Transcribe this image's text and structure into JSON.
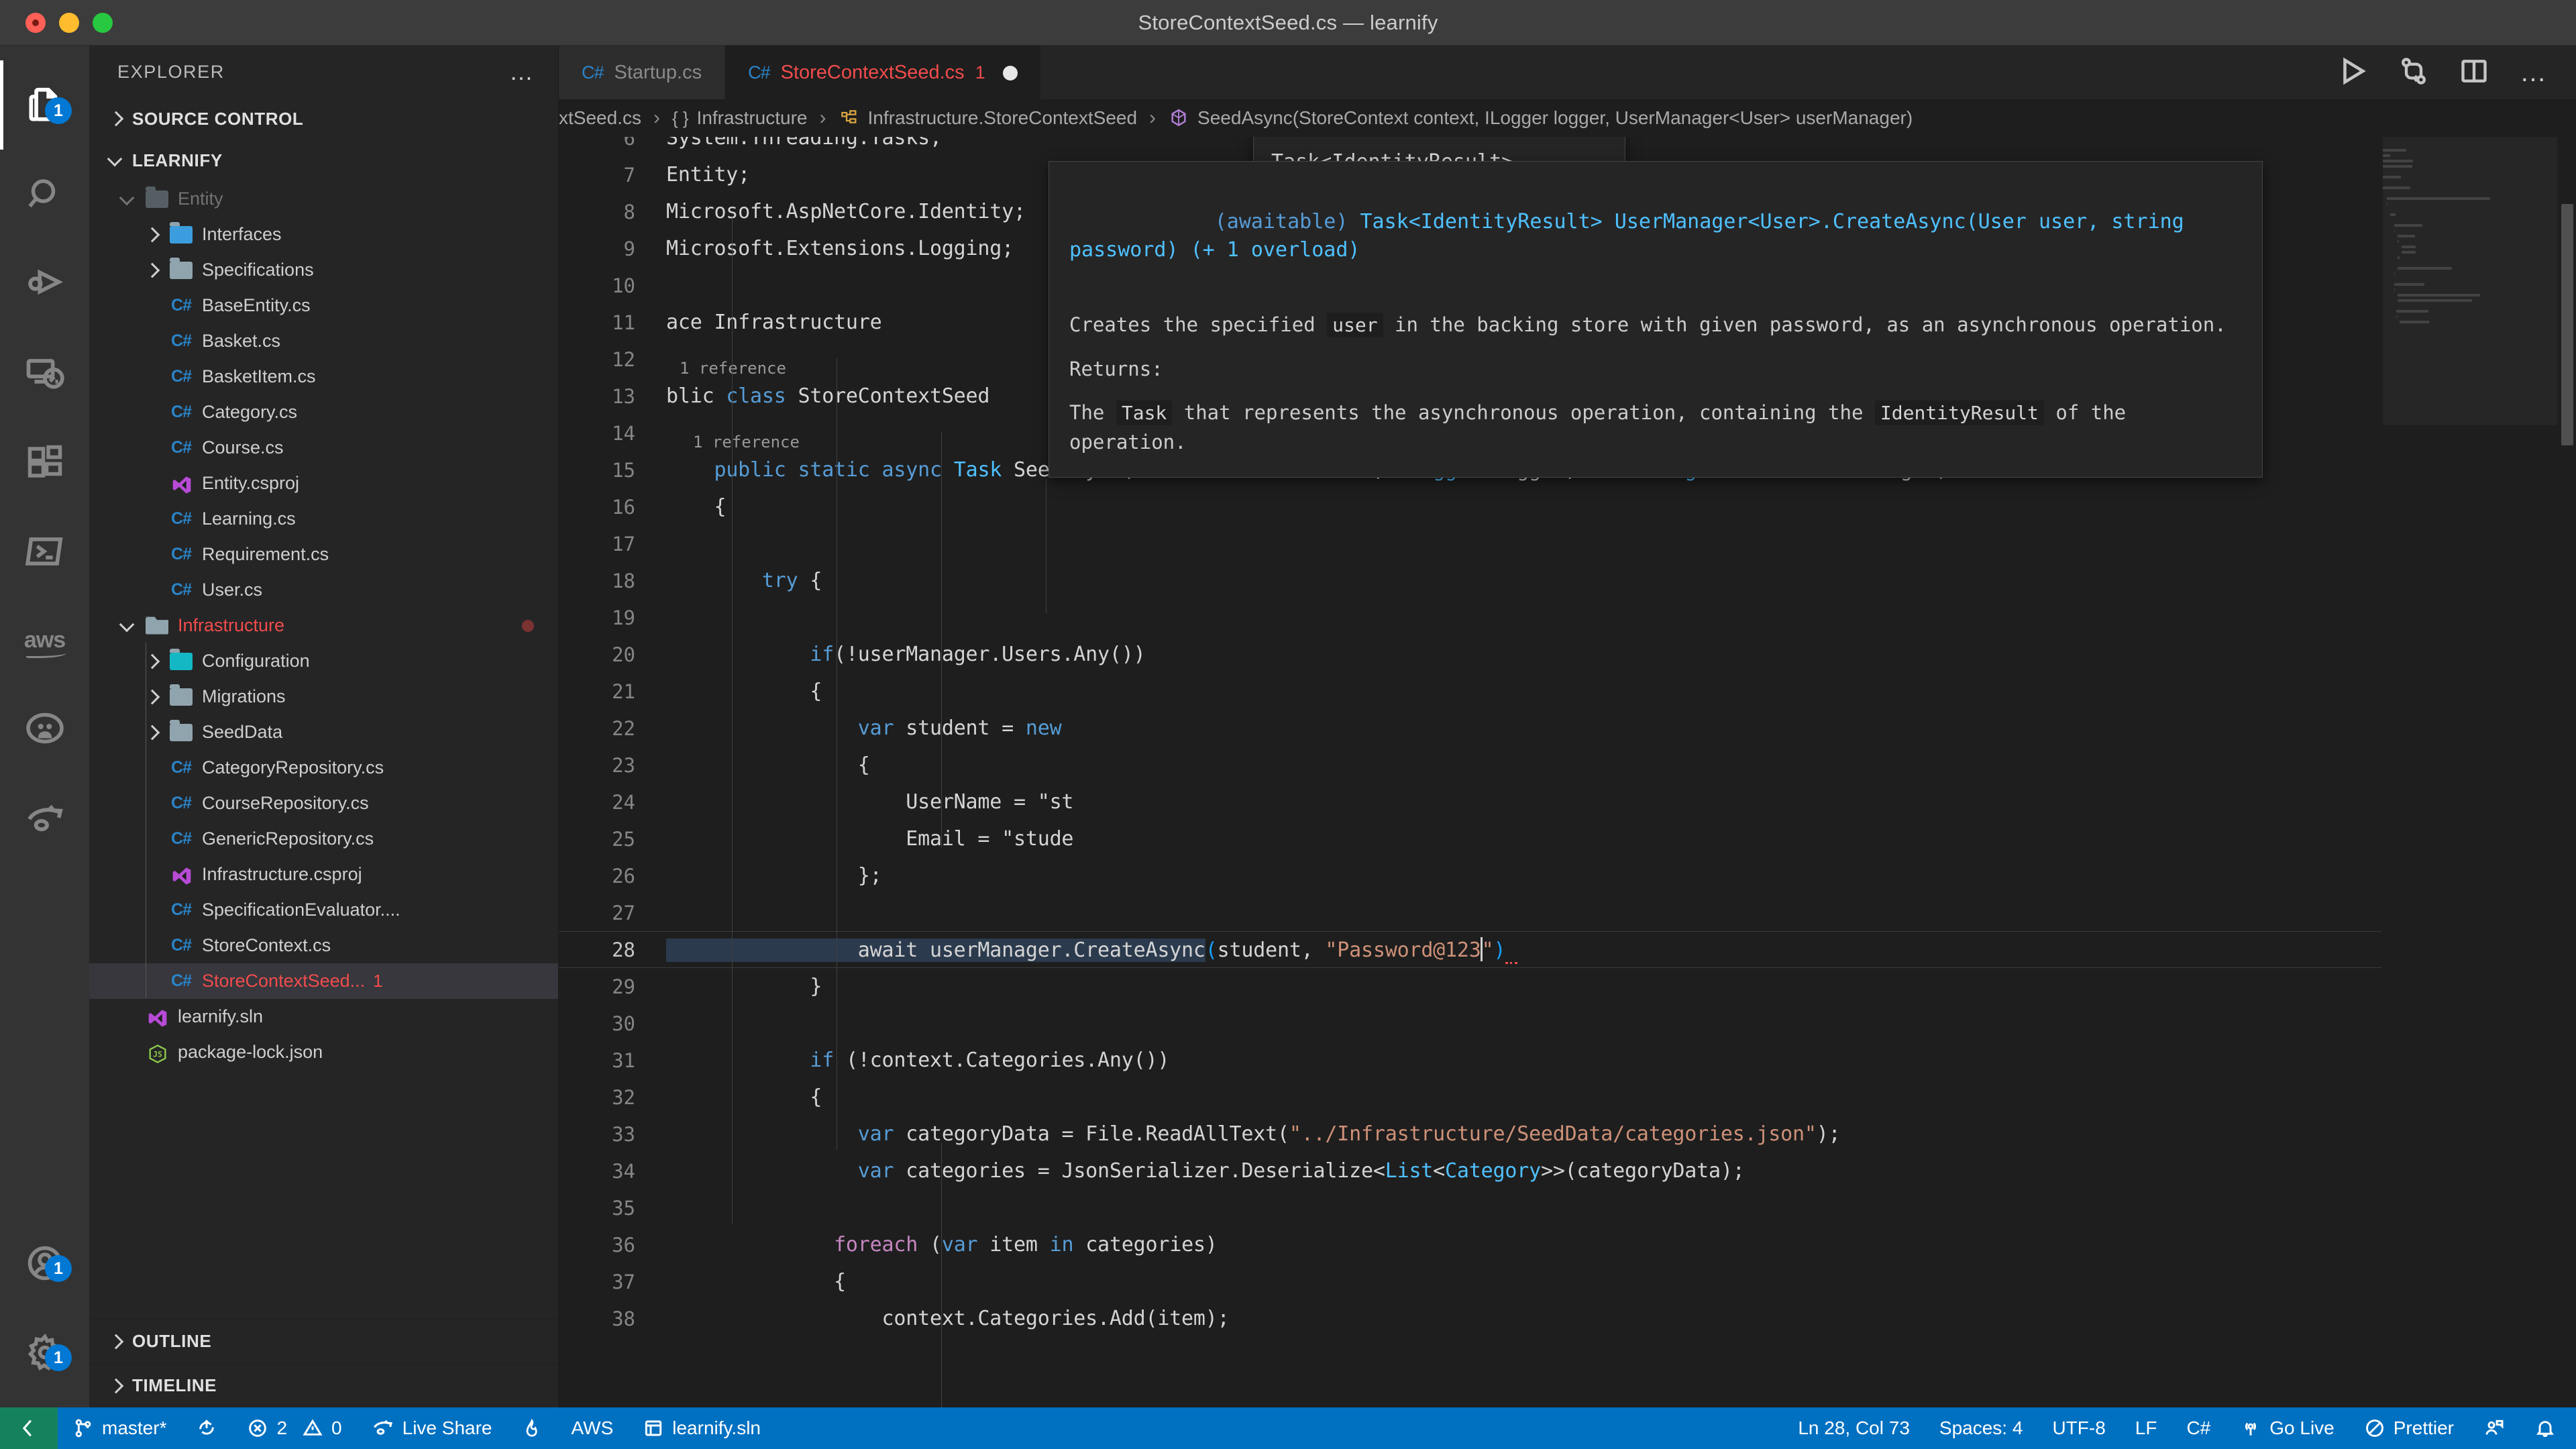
{
  "window": {
    "title": "StoreContextSeed.cs — learnify",
    "traffic_lights": [
      "close-button",
      "minimize-button",
      "zoom-button"
    ]
  },
  "activitybar": {
    "items": [
      {
        "name": "explorer",
        "icon": "files-icon",
        "badge": "1",
        "active": true
      },
      {
        "name": "search",
        "icon": "search-icon",
        "badge": ""
      },
      {
        "name": "run-and-debug",
        "icon": "debug-icon",
        "badge": ""
      },
      {
        "name": "remote-explorer",
        "icon": "remote-icon",
        "badge": ""
      },
      {
        "name": "extensions",
        "icon": "extensions-icon",
        "badge": ""
      },
      {
        "name": "terminal-profile",
        "icon": "powershell-icon",
        "badge": ""
      },
      {
        "name": "aws-toolkit",
        "icon": "aws-icon",
        "badge": "",
        "label": "aws"
      },
      {
        "name": "github",
        "icon": "github-icon",
        "badge": ""
      },
      {
        "name": "live-share",
        "icon": "live-share-icon",
        "badge": ""
      }
    ],
    "bottom_items": [
      {
        "name": "accounts",
        "icon": "account-icon",
        "badge": "1"
      },
      {
        "name": "manage",
        "icon": "gear-icon",
        "badge": "1"
      }
    ]
  },
  "sidebar": {
    "header_label": "EXPLORER",
    "more_actions": "…",
    "sections": [
      {
        "label": "SOURCE CONTROL",
        "expanded": false
      },
      {
        "label": "LEARNIFY",
        "expanded": true
      }
    ],
    "footer_sections": [
      {
        "label": "OUTLINE",
        "expanded": false
      },
      {
        "label": "TIMELINE",
        "expanded": false
      }
    ],
    "tree": [
      {
        "label": "Entity",
        "icon": "folder-icon",
        "indent": 1,
        "arrow": "down",
        "faded": true
      },
      {
        "label": "Interfaces",
        "icon": "folder-blue-icon",
        "indent": 2,
        "arrow": "right"
      },
      {
        "label": "Specifications",
        "icon": "folder-icon",
        "indent": 2,
        "arrow": "right"
      },
      {
        "label": "BaseEntity.cs",
        "icon": "csharp-icon",
        "indent": 2,
        "arrow": ""
      },
      {
        "label": "Basket.cs",
        "icon": "csharp-icon",
        "indent": 2,
        "arrow": ""
      },
      {
        "label": "BasketItem.cs",
        "icon": "csharp-icon",
        "indent": 2,
        "arrow": ""
      },
      {
        "label": "Category.cs",
        "icon": "csharp-icon",
        "indent": 2,
        "arrow": ""
      },
      {
        "label": "Course.cs",
        "icon": "csharp-icon",
        "indent": 2,
        "arrow": ""
      },
      {
        "label": "Entity.csproj",
        "icon": "visualstudio-icon",
        "indent": 2,
        "arrow": ""
      },
      {
        "label": "Learning.cs",
        "icon": "csharp-icon",
        "indent": 2,
        "arrow": ""
      },
      {
        "label": "Requirement.cs",
        "icon": "csharp-icon",
        "indent": 2,
        "arrow": ""
      },
      {
        "label": "User.cs",
        "icon": "csharp-icon",
        "indent": 2,
        "arrow": ""
      },
      {
        "label": "Infrastructure",
        "icon": "folder-open-icon",
        "indent": 1,
        "arrow": "down",
        "modified": true,
        "color": "red"
      },
      {
        "label": "Configuration",
        "icon": "folder-teal-icon",
        "indent": 2,
        "arrow": "right"
      },
      {
        "label": "Migrations",
        "icon": "folder-icon",
        "indent": 2,
        "arrow": "right"
      },
      {
        "label": "SeedData",
        "icon": "folder-icon",
        "indent": 2,
        "arrow": "right"
      },
      {
        "label": "CategoryRepository.cs",
        "icon": "csharp-icon",
        "indent": 2,
        "arrow": ""
      },
      {
        "label": "CourseRepository.cs",
        "icon": "csharp-icon",
        "indent": 2,
        "arrow": ""
      },
      {
        "label": "GenericRepository.cs",
        "icon": "csharp-icon",
        "indent": 2,
        "arrow": ""
      },
      {
        "label": "Infrastructure.csproj",
        "icon": "visualstudio-icon",
        "indent": 2,
        "arrow": ""
      },
      {
        "label": "SpecificationEvaluator....",
        "icon": "csharp-icon",
        "indent": 2,
        "arrow": ""
      },
      {
        "label": "StoreContext.cs",
        "icon": "csharp-icon",
        "indent": 2,
        "arrow": ""
      },
      {
        "label": "StoreContextSeed... 1",
        "icon": "csharp-icon",
        "indent": 2,
        "arrow": "",
        "color": "red",
        "selected": true
      },
      {
        "label": "learnify.sln",
        "icon": "visualstudio-icon",
        "indent": 1,
        "arrow": ""
      },
      {
        "label": "package-lock.json",
        "icon": "json-icon",
        "indent": 1,
        "arrow": ""
      }
    ]
  },
  "editor": {
    "tabs": [
      {
        "label": "Startup.cs",
        "icon": "csharp-icon",
        "active": false,
        "badge": "",
        "dirty": false
      },
      {
        "label": "StoreContextSeed.cs",
        "icon": "csharp-icon",
        "active": true,
        "badge": "1",
        "dirty": true
      }
    ],
    "actions": [
      {
        "name": "run-button",
        "icon": "play-icon"
      },
      {
        "name": "source-control-compare-button",
        "icon": "compare-icon"
      },
      {
        "name": "split-editor-button",
        "icon": "split-icon"
      },
      {
        "name": "more-actions-button",
        "icon": "ellipsis-icon",
        "label": "…"
      }
    ],
    "breadcrumb": [
      {
        "label": "xtSeed.cs",
        "icon": ""
      },
      {
        "label": "Infrastructure",
        "icon": "{ }"
      },
      {
        "label": "Infrastructure.StoreContextSeed",
        "icon": "namespace-icon"
      },
      {
        "label": "SeedAsync(StoreContext context, ILogger logger, UserManager<User> userManager)",
        "icon": "method-icon"
      }
    ],
    "code_lines": [
      {
        "num": "6",
        "text": "System.Threading.Tasks;",
        "clipped": true
      },
      {
        "num": "7",
        "text": "Entity;"
      },
      {
        "num": "8",
        "text": "Microsoft.AspNetCore.Identity;"
      },
      {
        "num": "9",
        "text": "Microsoft.Extensions.Logging;"
      },
      {
        "num": "10",
        "text": ""
      },
      {
        "num": "11",
        "text": "ace Infrastructure"
      },
      {
        "num": "12",
        "text": ""
      },
      {
        "num": "13",
        "text": "blic class StoreContextSeed",
        "codelens": "1 reference"
      },
      {
        "num": "14",
        "text": ""
      },
      {
        "num": "15",
        "text": "    public static async Task SeedAsync(StoreContext context, ILogger logger, UserManager<User> userManager)",
        "codelens": "1 reference"
      },
      {
        "num": "16",
        "text": "    {"
      },
      {
        "num": "17",
        "text": ""
      },
      {
        "num": "18",
        "text": "        try {"
      },
      {
        "num": "19",
        "text": ""
      },
      {
        "num": "20",
        "text": "            if(!userManager.Users.Any())"
      },
      {
        "num": "21",
        "text": "            {"
      },
      {
        "num": "22",
        "text": "                var student = new"
      },
      {
        "num": "23",
        "text": "                {"
      },
      {
        "num": "24",
        "text": "                    UserName = \"st"
      },
      {
        "num": "25",
        "text": "                    Email = \"stude"
      },
      {
        "num": "26",
        "text": "                };"
      },
      {
        "num": "27",
        "text": ""
      },
      {
        "num": "28",
        "text": "                await userManager.CreateAsync(student, \"Password@123\")",
        "current": true
      },
      {
        "num": "29",
        "text": "            }"
      },
      {
        "num": "30",
        "text": ""
      },
      {
        "num": "31",
        "text": "            if (!context.Categories.Any())"
      },
      {
        "num": "32",
        "text": "            {"
      },
      {
        "num": "33",
        "text": "                var categoryData = File.ReadAllText(\"../Infrastructure/SeedData/categories.json\");"
      },
      {
        "num": "34",
        "text": "                var categories = JsonSerializer.Deserialize<List<Category>>(categoryData);"
      },
      {
        "num": "35",
        "text": ""
      },
      {
        "num": "36",
        "text": "              foreach (var item in categories)"
      },
      {
        "num": "37",
        "text": "              {"
      },
      {
        "num": "38",
        "text": "                  context.Categories.Add(item);"
      }
    ]
  },
  "signature_help": {
    "return_type": "Task<IdentityResult>",
    "signature": "UserManager<User>.CreateAsync(User user, string"
  },
  "hover": {
    "signature_prefix": "(awaitable)",
    "signature_type": "Task<IdentityResult>",
    "signature_body": "UserManager<User>.CreateAsync(User user, string password) (+ 1 overload)",
    "description_1": "Creates the specified",
    "description_code_1": "user",
    "description_2": "in the backing store with given password, as an asynchronous operation.",
    "returns_label": "Returns:",
    "returns_1": "The",
    "returns_code_1": "Task",
    "returns_2": "that represents the asynchronous operation, containing the",
    "returns_code_2": "IdentityResult",
    "returns_3": "of the operation."
  },
  "statusbar": {
    "remote_icon": "remote-window-icon",
    "left_items": [
      {
        "name": "branch",
        "icon": "git-branch-icon",
        "label": "master*"
      },
      {
        "name": "sync-changes",
        "icon": "sync-icon",
        "label": ""
      },
      {
        "name": "problems",
        "icon": "error-icon",
        "label": "2",
        "icon2": "warning-icon",
        "label2": "0"
      },
      {
        "name": "live-share",
        "icon": "live-share-icon",
        "label": "Live Share"
      },
      {
        "name": "firebase",
        "icon": "flame-icon",
        "label": ""
      },
      {
        "name": "aws",
        "icon": "",
        "label": "AWS"
      },
      {
        "name": "solution",
        "icon": "solution-icon",
        "label": "learnify.sln"
      }
    ],
    "right_items": [
      {
        "name": "cursor-position",
        "icon": "",
        "label": "Ln 28, Col 73"
      },
      {
        "name": "indentation",
        "icon": "",
        "label": "Spaces: 4"
      },
      {
        "name": "encoding",
        "icon": "",
        "label": "UTF-8"
      },
      {
        "name": "eol",
        "icon": "",
        "label": "LF"
      },
      {
        "name": "language-mode",
        "icon": "",
        "label": "C#"
      },
      {
        "name": "go-live",
        "icon": "broadcast-icon",
        "label": "Go Live"
      },
      {
        "name": "prettier",
        "icon": "prettier-icon",
        "label": "Prettier"
      },
      {
        "name": "feedback",
        "icon": "feedback-icon",
        "label": ""
      },
      {
        "name": "notifications",
        "icon": "bell-icon",
        "label": ""
      }
    ]
  },
  "colors": {
    "accent": "#0070c1",
    "error": "#f14c4c",
    "remote": "#16825d",
    "badge": "#0078d4",
    "keyword": "#569cd6",
    "string": "#ce9178",
    "type": "#4ec9b0"
  }
}
